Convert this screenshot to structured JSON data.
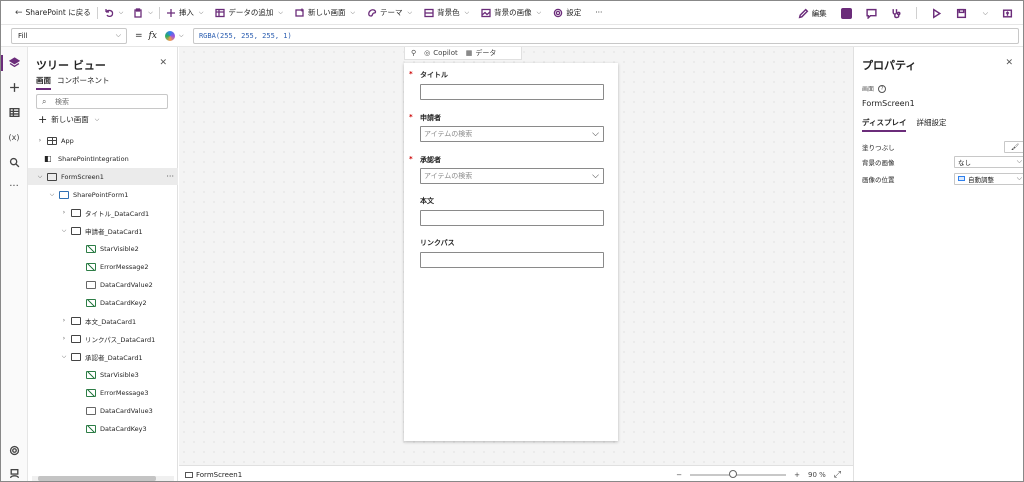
{
  "toolbar": {
    "back": "SharePoint に戻る",
    "insert": "挿入",
    "add_data": "データの追加",
    "new_screen": "新しい画面",
    "theme": "テーマ",
    "background_color": "背景色",
    "background_image": "背景の画像",
    "settings": "設定",
    "more": "···",
    "edit": "編集"
  },
  "formula_bar": {
    "property": "Fill",
    "equals": "=",
    "fx": "fx",
    "formula": "RGBA(255, 255, 255, 1)"
  },
  "tree": {
    "title": "ツリー ビュー",
    "tabs": [
      "画面",
      "コンポーネント"
    ],
    "search_placeholder": "検索",
    "new_screen": "新しい画面",
    "items": [
      {
        "label": "App"
      },
      {
        "label": "SharePointIntegration"
      },
      {
        "label": "FormScreen1"
      },
      {
        "label": "SharePointForm1"
      },
      {
        "label": "タイトル_DataCard1"
      },
      {
        "label": "申請者_DataCard1"
      },
      {
        "label": "StarVisible2"
      },
      {
        "label": "ErrorMessage2"
      },
      {
        "label": "DataCardValue2"
      },
      {
        "label": "DataCardKey2"
      },
      {
        "label": "本文_DataCard1"
      },
      {
        "label": "リンクパス_DataCard1"
      },
      {
        "label": "承認者_DataCard1"
      },
      {
        "label": "StarVisible3"
      },
      {
        "label": "ErrorMessage3"
      },
      {
        "label": "DataCardValue3"
      },
      {
        "label": "DataCardKey3"
      }
    ]
  },
  "canvas": {
    "copilot": "Copilot",
    "data": "データ",
    "fields": [
      {
        "label": "タイトル",
        "required": "*",
        "placeholder": ""
      },
      {
        "label": "申請者",
        "required": "*",
        "placeholder": "アイテムの検索"
      },
      {
        "label": "承認者",
        "required": "*",
        "placeholder": "アイテムの検索"
      },
      {
        "label": "本文",
        "required": "",
        "placeholder": ""
      },
      {
        "label": "リンクパス",
        "required": "",
        "placeholder": ""
      }
    ]
  },
  "status": {
    "screen": "FormScreen1",
    "minus": "−",
    "plus": "+",
    "zoom": "90 %",
    "zoom_fraction": 0.45
  },
  "properties": {
    "title": "プロパティ",
    "kind": "画面",
    "name": "FormScreen1",
    "tabs": [
      "ディスプレイ",
      "詳細設定"
    ],
    "rows": [
      {
        "label": "塗りつぶし",
        "value": ""
      },
      {
        "label": "背景の画像",
        "value": "なし"
      },
      {
        "label": "画像の位置",
        "value": "自動調整"
      }
    ]
  },
  "colors": {
    "accent": "#6b2c7a",
    "required": "#cc0000",
    "formula": "#2a5db0"
  }
}
